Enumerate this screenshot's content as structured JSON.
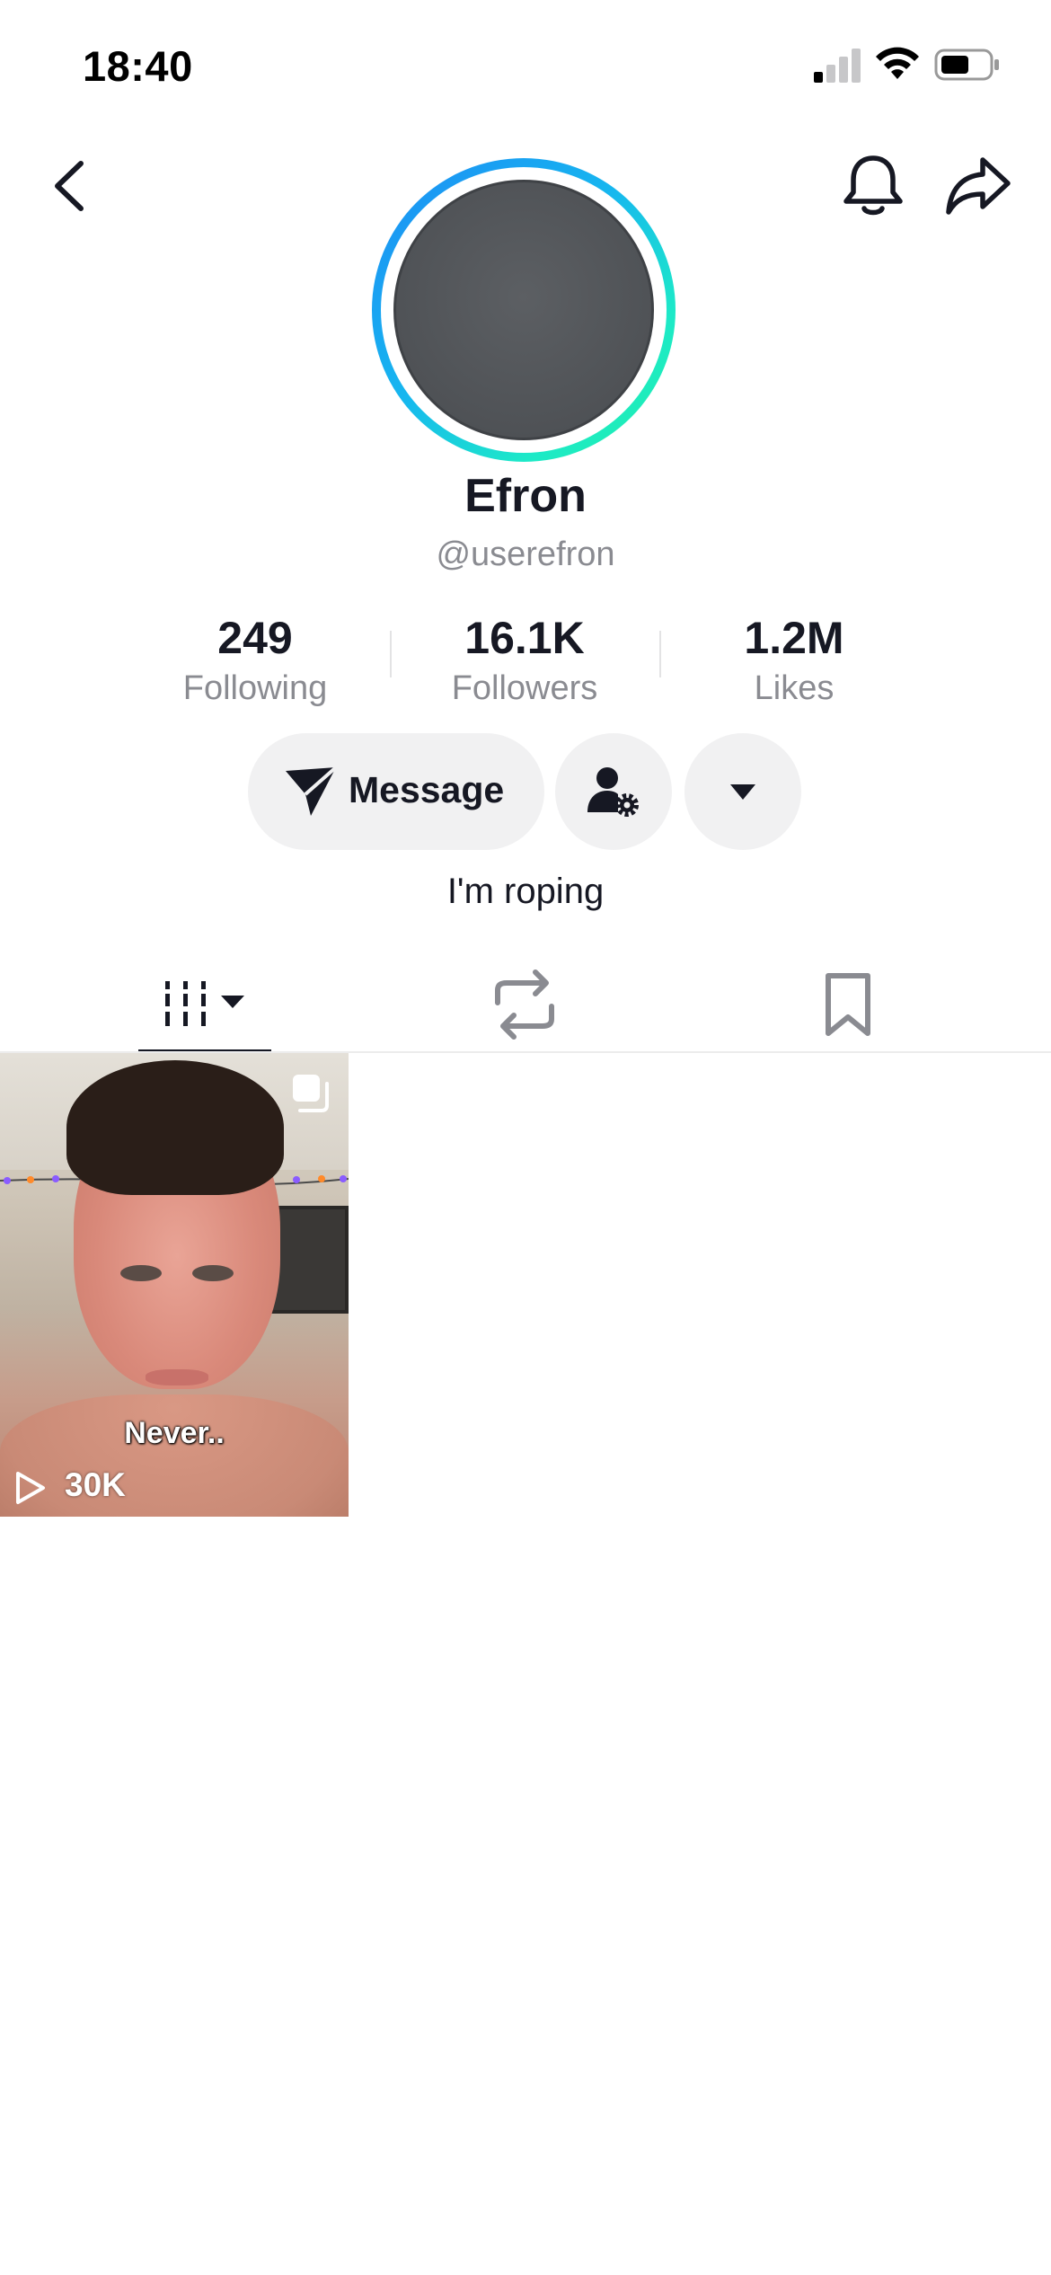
{
  "status_bar": {
    "time": "18:40"
  },
  "nav": {
    "back_icon": "chevron-left-icon",
    "bell_icon": "bell-icon",
    "share_icon": "share-arrow-icon"
  },
  "profile": {
    "display_name": "Efron",
    "username": "@userefron",
    "bio": "I'm roping",
    "avatar_ring_colors": [
      "#1e8bf5",
      "#20f2a8"
    ],
    "avatar_color": "#53565a"
  },
  "stats": [
    {
      "value": "249",
      "label": "Following"
    },
    {
      "value": "16.1K",
      "label": "Followers"
    },
    {
      "value": "1.2M",
      "label": "Likes"
    }
  ],
  "actions": {
    "message_label": "Message",
    "message_icon": "paper-plane-icon",
    "follow_settings_icon": "person-gear-icon",
    "more_icon": "caret-down-icon"
  },
  "tabs": [
    {
      "name": "videos",
      "icon": "grid-lines-icon",
      "active": true
    },
    {
      "name": "reposts",
      "icon": "repost-icon",
      "active": false
    },
    {
      "name": "saved",
      "icon": "bookmark-icon",
      "active": false
    }
  ],
  "videos": [
    {
      "caption": "Never..",
      "views": "30K",
      "multi_icon": "multi-clip-icon",
      "play_icon": "play-outline-icon"
    }
  ],
  "colors": {
    "text_primary": "#161823",
    "text_secondary": "#8a8b91",
    "button_bg": "#f1f1f2"
  }
}
